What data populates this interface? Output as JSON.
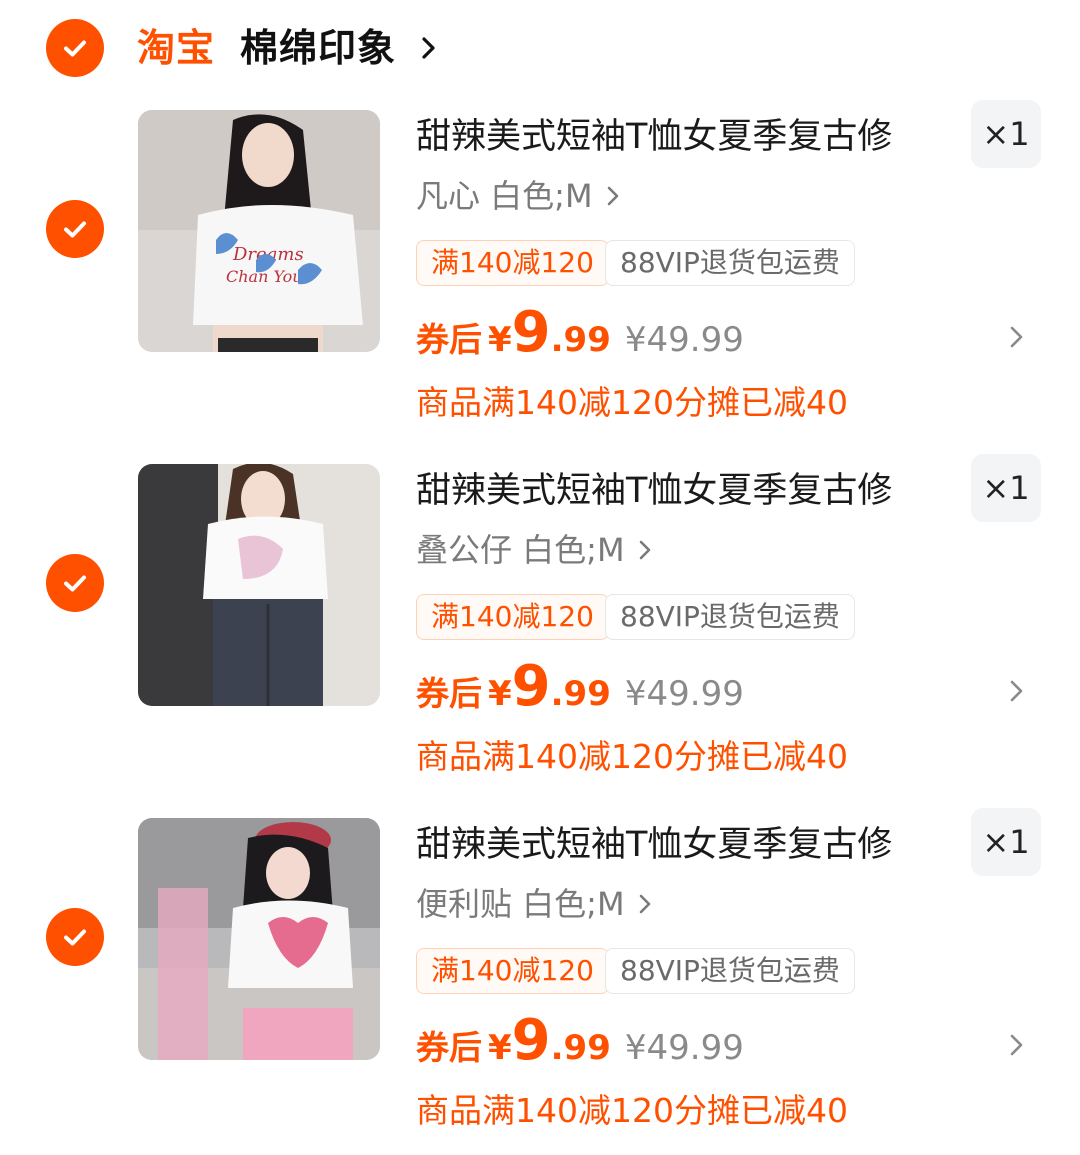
{
  "store": {
    "platform": "淘宝",
    "name": "棉绵印象"
  },
  "items": [
    {
      "title": "甜辣美式短袖T恤女夏季复古修",
      "quantity": "×1",
      "sku": "凡心 白色;M",
      "tags": [
        "满140减120",
        "88VIP退货包运费"
      ],
      "price_label": "券后",
      "currency": "¥",
      "price_int": "9",
      "price_dec": ".99",
      "original_price": "¥49.99",
      "promo_note": "商品满140减120分摊已减40",
      "checked": true
    },
    {
      "title": "甜辣美式短袖T恤女夏季复古修",
      "quantity": "×1",
      "sku": "叠公仔 白色;M",
      "tags": [
        "满140减120",
        "88VIP退货包运费"
      ],
      "price_label": "券后",
      "currency": "¥",
      "price_int": "9",
      "price_dec": ".99",
      "original_price": "¥49.99",
      "promo_note": "商品满140减120分摊已减40",
      "checked": true
    },
    {
      "title": "甜辣美式短袖T恤女夏季复古修",
      "quantity": "×1",
      "sku": "便利贴 白色;M",
      "tags": [
        "满140减120",
        "88VIP退货包运费"
      ],
      "price_label": "券后",
      "currency": "¥",
      "price_int": "9",
      "price_dec": ".99",
      "original_price": "¥49.99",
      "promo_note": "商品满140减120分摊已减40",
      "checked": true
    }
  ],
  "colors": {
    "accent": "#ff5000",
    "text_primary": "#1a1a1a",
    "text_secondary": "#7a7a7a",
    "qty_bg": "#f3f4f6"
  },
  "icons": {
    "check": "checkmark-icon",
    "chevron": "chevron-right-icon"
  }
}
